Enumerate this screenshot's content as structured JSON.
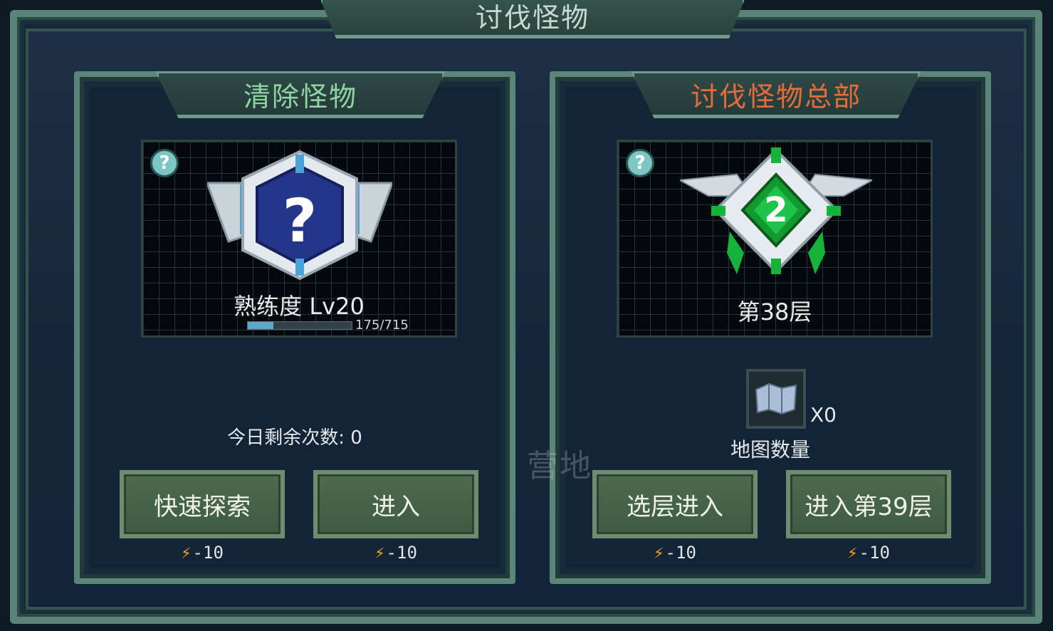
{
  "header": {
    "title": "讨伐怪物"
  },
  "left_panel": {
    "title": "清除怪物",
    "help_icon": "?",
    "badge": "question-badge",
    "proficiency_label": "熟练度 Lv20",
    "xp_text": "175/715",
    "xp_fraction": 0.245,
    "remaining_label": "今日剩余次数: 0",
    "buttons": [
      {
        "label": "快速探索",
        "cost": "-10"
      },
      {
        "label": "进入",
        "cost": "-10"
      }
    ]
  },
  "right_panel": {
    "title": "讨伐怪物总部",
    "help_icon": "?",
    "badge": "hq-emblem",
    "floor_label": "第38层",
    "map_count": "X0",
    "map_label": "地图数量",
    "buttons": [
      {
        "label": "选层进入",
        "cost": "-10"
      },
      {
        "label": "进入第39层",
        "cost": "-10"
      }
    ]
  },
  "watermark": "营地",
  "colors": {
    "frame": "#5d8478",
    "left_title": "#8fd5a3",
    "right_title": "#e86b3a",
    "energy": "#f6a017"
  }
}
